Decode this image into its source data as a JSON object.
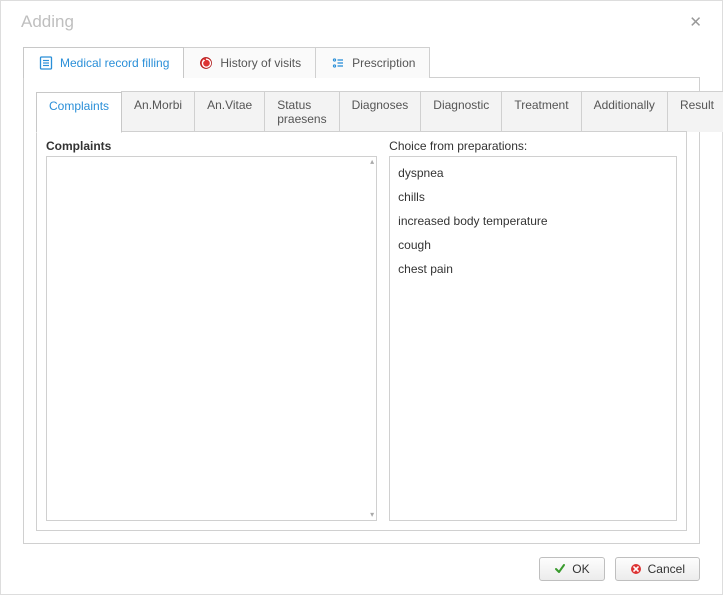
{
  "dialog": {
    "title": "Adding"
  },
  "top_tabs": [
    {
      "label": "Medical record filling",
      "active": true,
      "icon": "record"
    },
    {
      "label": "History of visits",
      "active": false,
      "icon": "history"
    },
    {
      "label": "Prescription",
      "active": false,
      "icon": "prescription"
    }
  ],
  "sub_tabs": [
    {
      "label": "Complaints",
      "active": true
    },
    {
      "label": "An.Morbi",
      "active": false
    },
    {
      "label": "An.Vitae",
      "active": false
    },
    {
      "label": "Status praesens",
      "active": false
    },
    {
      "label": "Diagnoses",
      "active": false
    },
    {
      "label": "Diagnostic",
      "active": false
    },
    {
      "label": "Treatment",
      "active": false
    },
    {
      "label": "Additionally",
      "active": false
    },
    {
      "label": "Result",
      "active": false
    }
  ],
  "panel": {
    "left_label": "Complaints",
    "right_label": "Choice from preparations:",
    "complaints_value": ""
  },
  "preparations": [
    "dyspnea",
    "chills",
    "increased body temperature",
    "cough",
    "chest pain"
  ],
  "buttons": {
    "ok": "OK",
    "cancel": "Cancel"
  }
}
